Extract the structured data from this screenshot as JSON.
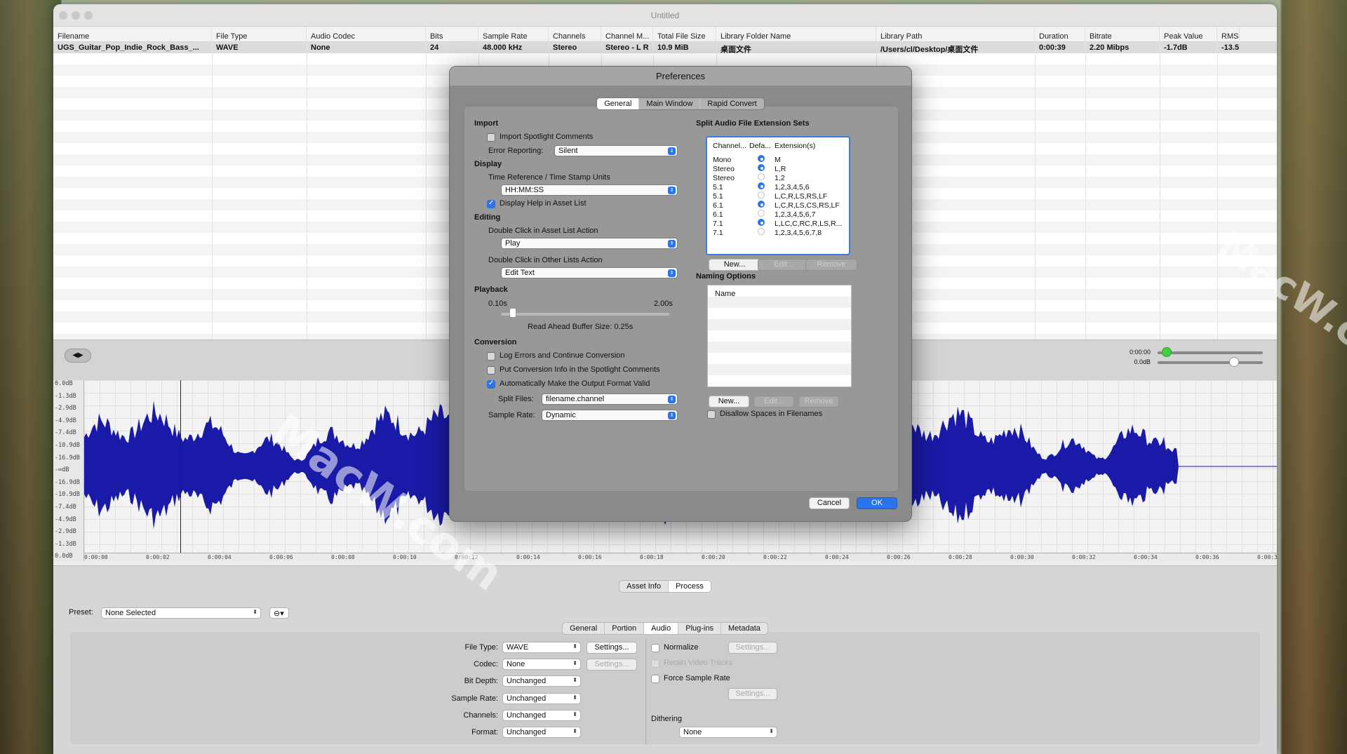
{
  "window": {
    "title": "Untitled"
  },
  "columns": [
    "Filename",
    "File Type",
    "Audio Codec",
    "Bits",
    "Sample Rate",
    "Channels",
    "Channel M...",
    "Total File Size",
    "Library Folder Name",
    "Library Path",
    "Duration",
    "Bitrate",
    "Peak Value",
    "RMS V"
  ],
  "row": [
    "UGS_Guitar_Pop_Indie_Rock_Bass_...",
    "WAVE",
    "None",
    "24",
    "48.000 kHz",
    "Stereo",
    "Stereo - L R",
    "10.9 MiB",
    "桌面文件",
    "/Users/cl/Desktop/桌面文件",
    "0:00:39",
    "2.20 Mibps",
    "-1.7dB",
    "-13.5"
  ],
  "player": {
    "time": "0:00:00",
    "gain": "0.0dB"
  },
  "db_labels": [
    "0.0dB",
    "-1.3dB",
    "-2.9dB",
    "-4.9dB",
    "-7.4dB",
    "-10.9dB",
    "-16.9dB",
    "-∞dB",
    "-16.9dB",
    "-10.9dB",
    "-7.4dB",
    "-4.9dB",
    "-2.9dB",
    "-1.3dB",
    "0.0dB"
  ],
  "time_ticks": [
    "0:00:00",
    "0:00:02",
    "0:00:04",
    "0:00:06",
    "0:00:08",
    "0:00:10",
    "0:00:12",
    "0:00:14",
    "0:00:16",
    "0:00:18",
    "0:00:20",
    "0:00:22",
    "0:00:24",
    "0:00:26",
    "0:00:28",
    "0:00:30",
    "0:00:32",
    "0:00:34",
    "0:00:36",
    "0:00:3"
  ],
  "bottom": {
    "tabs": [
      "Asset Info",
      "Process"
    ],
    "preset_label": "Preset:",
    "preset_value": "None Selected",
    "subtabs": [
      "General",
      "Portion",
      "Audio",
      "Plug-ins",
      "Metadata"
    ],
    "file_type_label": "File Type:",
    "file_type": "WAVE",
    "codec_label": "Codec:",
    "codec": "None",
    "bit_depth_label": "Bit Depth:",
    "bit_depth": "Unchanged",
    "sample_rate_label": "Sample Rate:",
    "sample_rate": "Unchanged",
    "channels_label": "Channels:",
    "channels": "Unchanged",
    "format_label": "Format:",
    "format": "Unchanged",
    "settings": "Settings...",
    "normalize": "Normalize",
    "retain": "Retain Video Tracks",
    "force_sr": "Force Sample Rate",
    "dithering": "Dithering",
    "dithering_value": "None"
  },
  "prefs": {
    "title": "Preferences",
    "tabs": [
      "General",
      "Main Window",
      "Rapid Convert"
    ],
    "import": "Import",
    "import_spotlight": "Import Spotlight Comments",
    "error_reporting_label": "Error Reporting:",
    "error_reporting": "Silent",
    "display": "Display",
    "time_ref_label": "Time Reference / Time Stamp Units",
    "time_ref": "HH:MM:SS",
    "display_help": "Display Help in Asset List",
    "editing": "Editing",
    "dbl_asset_label": "Double Click in Asset List Action",
    "dbl_asset": "Play",
    "dbl_other_label": "Double Click in Other Lists Action",
    "dbl_other": "Edit Text",
    "playback": "Playback",
    "slider_min": "0.10s",
    "slider_max": "2.00s",
    "buffer": "Read Ahead Buffer Size: 0.25s",
    "conversion": "Conversion",
    "log_errors": "Log Errors and Continue Conversion",
    "put_info": "Put Conversion Info in the Spotlight Comments",
    "auto_valid": "Automatically Make the Output Format Valid",
    "split_label": "Split Files:",
    "split_value": "filename.channel",
    "sr_label": "Sample Rate:",
    "sr_value": "Dynamic",
    "split_sets": "Split Audio File Extension Sets",
    "ext_headers": [
      "Channel...",
      "Defa...",
      "Extension(s)"
    ],
    "ext_rows": [
      {
        "ch": "Mono",
        "def": true,
        "ext": "M"
      },
      {
        "ch": "Stereo",
        "def": true,
        "ext": "L,R"
      },
      {
        "ch": "Stereo",
        "def": false,
        "ext": "1,2"
      },
      {
        "ch": "5.1",
        "def": true,
        "ext": "1,2,3,4,5,6"
      },
      {
        "ch": "5.1",
        "def": false,
        "ext": "L,C,R,LS,RS,LF"
      },
      {
        "ch": "6.1",
        "def": true,
        "ext": "L,C,R,LS,CS,RS,LF"
      },
      {
        "ch": "6.1",
        "def": false,
        "ext": "1,2,3,4,5,6,7"
      },
      {
        "ch": "7.1",
        "def": true,
        "ext": "L,LC,C,RC,R,LS,R..."
      },
      {
        "ch": "7.1",
        "def": false,
        "ext": "1,2,3,4,5,6,7,8"
      }
    ],
    "new": "New...",
    "edit": "Edit...",
    "remove": "Remove",
    "naming": "Naming Options",
    "name_header": "Name",
    "disallow": "Disallow Spaces in Filenames",
    "cancel": "Cancel",
    "ok": "OK"
  }
}
